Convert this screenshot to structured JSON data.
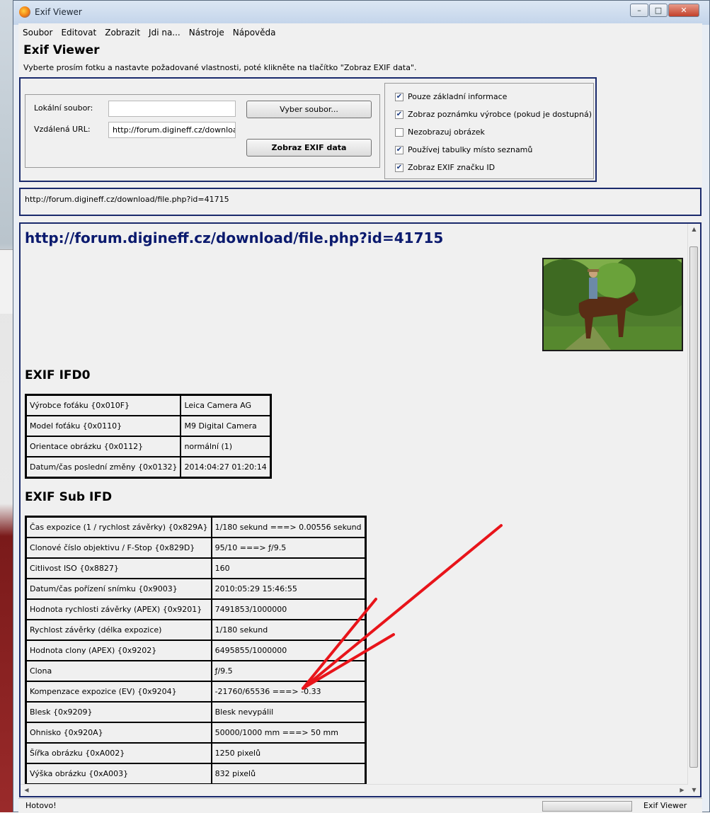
{
  "window": {
    "title": "Exif Viewer",
    "controls": {
      "minimize": "–",
      "maximize": "□",
      "close": "✕"
    }
  },
  "menu": [
    "Soubor",
    "Editovat",
    "Zobrazit",
    "Jdi na...",
    "Nástroje",
    "Nápověda"
  ],
  "page": {
    "heading": "Exif Viewer",
    "instructions": "Vyberte prosím fotku a nastavte požadované vlastnosti, poté klikněte na tlačítko \"Zobraz EXIF data\"."
  },
  "form": {
    "local_label": "Lokální soubor:",
    "local_value": "",
    "remote_label": "Vzdálená URL:",
    "remote_value": "http://forum.digineff.cz/download/file.php?id=41715",
    "choose_button": "Vyber soubor...",
    "show_button": "Zobraz EXIF data"
  },
  "options": [
    {
      "label": "Pouze základní informace",
      "checked": true
    },
    {
      "label": "Zobraz poznámku výrobce (pokud je dostupná)",
      "checked": true
    },
    {
      "label": "Nezobrazuj obrázek",
      "checked": false
    },
    {
      "label": "Používej tabulky místo seznamů",
      "checked": true
    },
    {
      "label": "Zobraz EXIF značku ID",
      "checked": true
    }
  ],
  "current_url": "http://forum.digineff.cz/download/file.php?id=41715",
  "content": {
    "url_heading": "http://forum.digineff.cz/download/file.php?id=41715",
    "ifd0": {
      "title": "EXIF IFD0",
      "rows": [
        [
          "Výrobce foťáku {0x010F}",
          "Leica Camera AG"
        ],
        [
          "Model foťáku {0x0110}",
          "M9 Digital Camera"
        ],
        [
          "Orientace obrázku {0x0112}",
          "normální (1)"
        ],
        [
          "Datum/čas poslední změny {0x0132}",
          "2014:04:27 01:20:14"
        ]
      ]
    },
    "subifd": {
      "title": "EXIF Sub IFD",
      "rows": [
        [
          "Čas expozice (1 / rychlost závěrky) {0x829A}",
          "1/180 sekund ===> 0.00556 sekund"
        ],
        [
          "Clonové číslo objektivu / F-Stop {0x829D}",
          "95/10 ===> ƒ/9.5"
        ],
        [
          "Citlivost ISO {0x8827}",
          "160"
        ],
        [
          "Datum/čas pořízení snímku {0x9003}",
          "2010:05:29 15:46:55"
        ],
        [
          "Hodnota rychlosti závěrky (APEX) {0x9201}",
          "7491853/1000000"
        ],
        [
          "Rychlost závěrky (délka expozice)",
          "1/180 sekund"
        ],
        [
          "Hodnota clony (APEX) {0x9202}",
          "6495855/1000000"
        ],
        [
          "Clona",
          "ƒ/9.5"
        ],
        [
          "Kompenzace expozice (EV) {0x9204}",
          "-21760/65536 ===> -0.33"
        ],
        [
          "Blesk {0x9209}",
          "Blesk nevypálil"
        ],
        [
          "Ohnisko {0x920A}",
          "50000/1000 mm ===> 50 mm"
        ],
        [
          "Šířka obrázku {0xA002}",
          "1250 pixelů"
        ],
        [
          "Výška obrázku {0xA003}",
          "832 pixelů"
        ]
      ]
    }
  },
  "status": {
    "left": "Hotovo!",
    "right": "Exif Viewer"
  },
  "colors": {
    "accent_border": "#1a2a6c",
    "link": "#0b1a6e",
    "annotation": "#e8141a"
  }
}
